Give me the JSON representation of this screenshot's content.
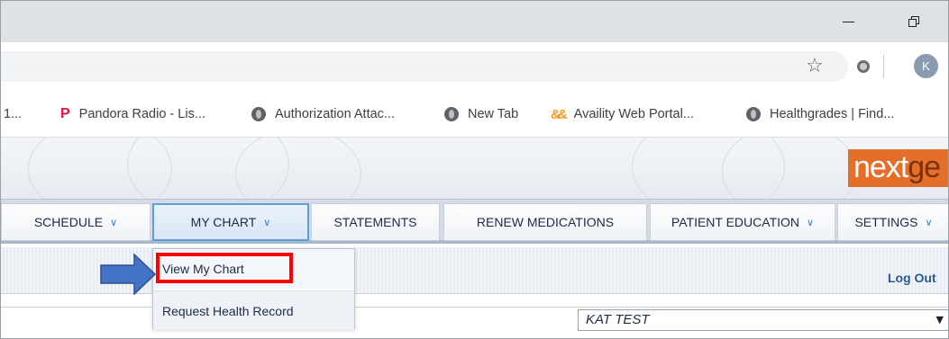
{
  "browser": {
    "profile_initial": "K",
    "icons": {
      "star": "bookmark-star-icon",
      "extension": "extension-icon",
      "minimize": "minimize-icon",
      "restore": "restore-icon"
    }
  },
  "bookmarks": [
    {
      "label": "1...",
      "icon": "none"
    },
    {
      "label": "Pandora Radio - Lis...",
      "icon": "pandora-icon"
    },
    {
      "label": "Authorization Attac...",
      "icon": "globe-icon"
    },
    {
      "label": "New Tab",
      "icon": "globe-icon"
    },
    {
      "label": "Availity Web Portal...",
      "icon": "availity-icon"
    },
    {
      "label": "Healthgrades | Find...",
      "icon": "globe-icon"
    }
  ],
  "header": {
    "logo_prefix": "next",
    "logo_suffix": "ge",
    "brand_color": "#e46f2a"
  },
  "nav": {
    "items": [
      {
        "label": "SCHEDULE",
        "has_dropdown": true
      },
      {
        "label": "MY CHART",
        "has_dropdown": true,
        "active": true
      },
      {
        "label": "STATEMENTS",
        "has_dropdown": false
      },
      {
        "label": "RENEW MEDICATIONS",
        "has_dropdown": false
      },
      {
        "label": "PATIENT EDUCATION",
        "has_dropdown": true
      },
      {
        "label": "SETTINGS",
        "has_dropdown": true
      }
    ],
    "chevron": "∨"
  },
  "dropdown": {
    "items": [
      {
        "label": "View My Chart"
      },
      {
        "label": "Request Health Record"
      }
    ],
    "highlight_color": "#ff0000",
    "pointer_color": "#4472c4"
  },
  "account": {
    "logout_label": "Log Out"
  },
  "patient_selector": {
    "value": "KAT TEST"
  }
}
